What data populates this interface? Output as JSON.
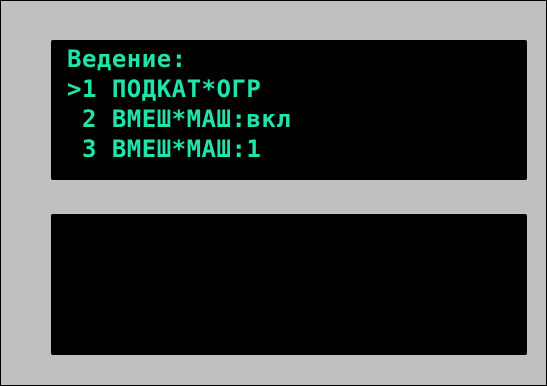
{
  "display": {
    "title": "Ведение:",
    "items": [
      {
        "marker": ">",
        "text": "1 ПОДКАТ*ОГР"
      },
      {
        "marker": " ",
        "text": "2 ВМЕШ*МАШ:вкл"
      },
      {
        "marker": " ",
        "text": "3 ВМЕШ*МАШ:1"
      }
    ],
    "text_color": "#22e3aa",
    "background_color": "#c0c0c0",
    "screen_color": "#000000"
  }
}
